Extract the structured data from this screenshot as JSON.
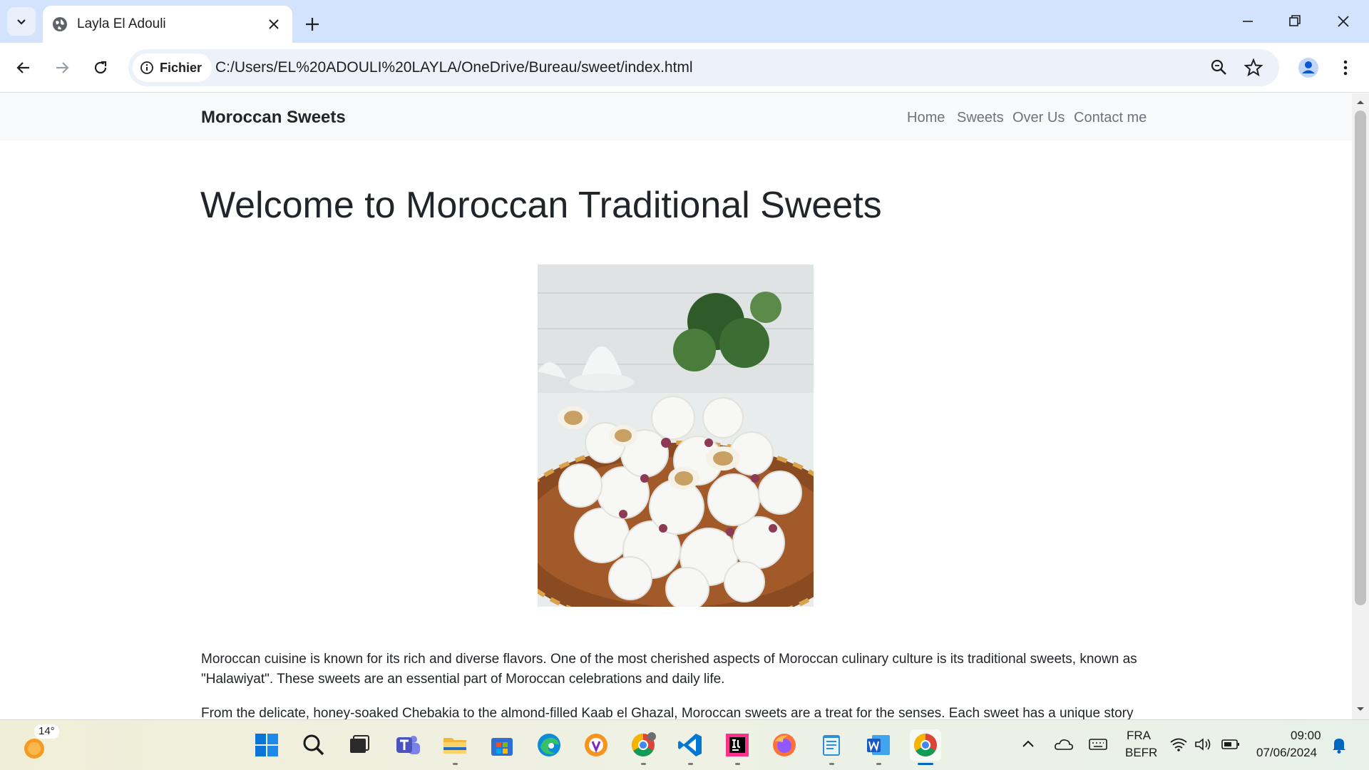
{
  "browser": {
    "tab_title": "Layla El Adouli",
    "site_info_label": "Fichier",
    "url": "C:/Users/EL%20ADOULI%20LAYLA/OneDrive/Bureau/sweet/index.html"
  },
  "site": {
    "brand": "Moroccan Sweets",
    "nav": [
      "Home",
      "Sweets",
      "Over Us",
      "Contact me"
    ],
    "heading": "Welcome to Moroccan Traditional Sweets",
    "paragraphs": [
      "Moroccan cuisine is known for its rich and diverse flavors. One of the most cherished aspects of Moroccan culinary culture is its traditional sweets, known as \"Halawiyat\". These sweets are an essential part of Moroccan celebrations and daily life.",
      "From the delicate, honey-soaked Chebakia to the almond-filled Kaab el Ghazal, Moroccan sweets are a treat for the senses. Each sweet has a unique story"
    ]
  },
  "taskbar": {
    "weather_temp": "14°",
    "apps": [
      "start-icon",
      "search-icon",
      "task-view-icon",
      "teams-icon",
      "file-explorer-icon",
      "store-icon",
      "edge-icon",
      "avast-browser-icon",
      "chrome-profile-icon",
      "vscode-icon",
      "intellij-icon",
      "firefox-icon",
      "notepad-icon",
      "word-icon",
      "chrome-icon"
    ],
    "language_top": "FRA",
    "language_bottom": "BEFR",
    "time": "09:00",
    "date": "07/06/2024"
  },
  "colors": {
    "tabstrip": "#d3e3fd",
    "navbar_bg": "#f8f9fa",
    "text": "#212529",
    "nav_link": "#6c757d",
    "accent": "#0067c0"
  }
}
